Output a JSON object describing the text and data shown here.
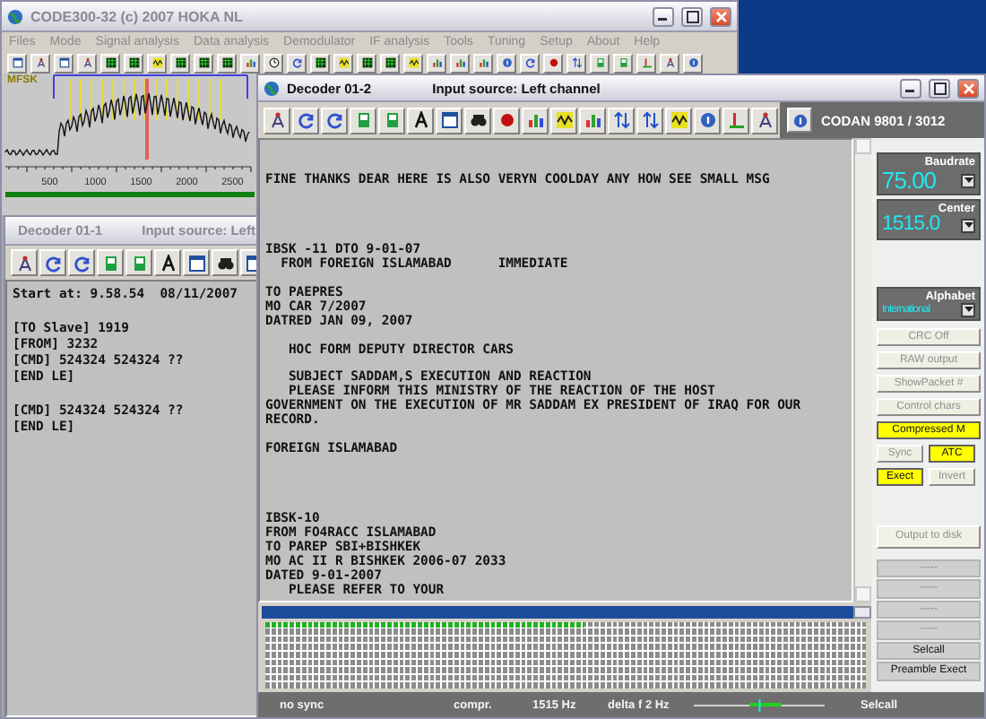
{
  "main_window": {
    "title": "CODE300-32 (c) 2007 HOKA NL",
    "menu": [
      "Files",
      "Mode",
      "Signal analysis",
      "Data analysis",
      "Demodulator",
      "IF analysis",
      "Tools",
      "Tuning",
      "Setup",
      "About",
      "Help"
    ]
  },
  "spectrum": {
    "mode": "MFSK",
    "axis_labels": [
      "500",
      "1000",
      "1500",
      "2000",
      "2500"
    ]
  },
  "decoder_1": {
    "title": "Decoder 01-1",
    "source": "Input source: Left",
    "blocks": [
      [
        "Start at: 9.58.54  08/11/2007"
      ],
      [
        "[TO Slave] 1919",
        "[FROM] 3232",
        "[CMD] 524324 524324 ??",
        "[END LE]"
      ],
      [
        "[CMD] 524324 524324 ??",
        "[END LE]"
      ]
    ]
  },
  "decoder_2": {
    "title": "Decoder 01-2",
    "source": "Input source: Left channel",
    "system": "CODAN 9801 / 3012",
    "blocks": [
      [
        "FINE THANKS DEAR HERE IS ALSO VERYN COOLDAY ANY HOW SEE SMALL MSG"
      ],
      [
        "IBSK -11 DTO 9-01-07",
        "  FROM FOREIGN ISLAMABAD      IMMEDIATE"
      ],
      [
        "TO PAEPRES",
        "MO CAR 7/2007",
        "DATRED JAN 09, 2007"
      ],
      [
        "   HOC FORM DEPUTY DIRECTOR CARS"
      ],
      [
        "   SUBJECT SADDAM,S EXECUTION AND REACTION",
        "   PLEASE INFORM THIS MINISTRY OF THE REACTION OF THE HOST",
        "GOVERNMENT ON THE EXECUTION OF MR SADDAM EX PRESIDENT OF IRAQ FOR OUR",
        "RECORD."
      ],
      [
        "FOREIGN ISLAMABAD"
      ],
      [
        "IBSK-10",
        "FROM FO4RACC ISLAMABAD",
        "TO PAREP SBI+BISHKEK",
        "MO AC II R BISHKEK 2006-07 2033",
        "DATED 9-01-2007",
        "   PLEASE REFER TO YOUR"
      ]
    ],
    "baudrate": {
      "label": "Baudrate",
      "value": "75.00"
    },
    "center": {
      "label": "Center",
      "value": "1515.0"
    },
    "alphabet": {
      "label": "Alphabet",
      "value": "International"
    },
    "options": [
      {
        "label": "CRC Off",
        "kind": "wide",
        "on": false
      },
      {
        "label": "RAW output",
        "kind": "wide",
        "on": false
      },
      {
        "label": "ShowPacket #",
        "kind": "wide",
        "on": false
      },
      {
        "label": "Control chars",
        "kind": "wide",
        "on": false
      },
      {
        "label": "Compressed M",
        "kind": "wide",
        "on": true
      },
      {
        "label": "Sync",
        "kind": "half",
        "on": false
      },
      {
        "label": "ATC",
        "kind": "half",
        "on": true
      },
      {
        "label": "Exect",
        "kind": "half",
        "on": true
      },
      {
        "label": "Invert",
        "kind": "half",
        "on": false
      }
    ],
    "output_button": "Output to disk",
    "slots": [
      {
        "label": "-----",
        "kind": "empty"
      },
      {
        "label": "-----",
        "kind": "empty"
      },
      {
        "label": "-----",
        "kind": "empty"
      },
      {
        "label": "-----",
        "kind": "empty"
      },
      {
        "label": "Selcall",
        "kind": "entry"
      },
      {
        "label": "Preamble Exect",
        "kind": "entry"
      }
    ],
    "buffer": {
      "level": 0.53
    },
    "status": {
      "sync": "no sync",
      "mode": "compr.",
      "frequency": "1515 Hz",
      "delta": "delta f 2 Hz",
      "tuning": {
        "level": 0.5
      },
      "call": "Selcall"
    }
  }
}
